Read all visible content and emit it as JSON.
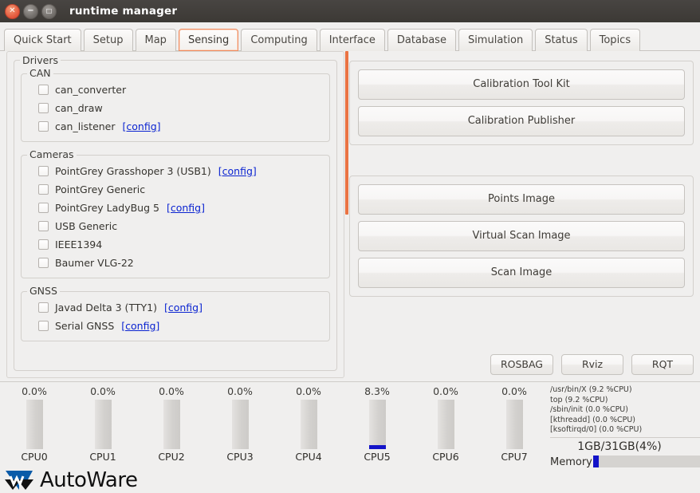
{
  "window": {
    "title": "runtime manager",
    "buttons": [
      {
        "name": "close",
        "glyph": "✕"
      },
      {
        "name": "minimize",
        "glyph": "−"
      },
      {
        "name": "maximize",
        "glyph": "□"
      }
    ]
  },
  "tabs": [
    {
      "label": "Quick Start",
      "active": false
    },
    {
      "label": "Setup",
      "active": false
    },
    {
      "label": "Map",
      "active": false
    },
    {
      "label": "Sensing",
      "active": true
    },
    {
      "label": "Computing",
      "active": false
    },
    {
      "label": "Interface",
      "active": false
    },
    {
      "label": "Database",
      "active": false
    },
    {
      "label": "Simulation",
      "active": false
    },
    {
      "label": "Status",
      "active": false
    },
    {
      "label": "Topics",
      "active": false
    }
  ],
  "drivers": {
    "legend": "Drivers",
    "groups": [
      {
        "legend": "CAN",
        "items": [
          {
            "label": "can_converter",
            "checked": false,
            "config": ""
          },
          {
            "label": "can_draw",
            "checked": false,
            "config": ""
          },
          {
            "label": "can_listener",
            "checked": false,
            "config": "[config]"
          }
        ]
      },
      {
        "legend": "Cameras",
        "items": [
          {
            "label": "PointGrey Grasshoper 3 (USB1)",
            "checked": false,
            "config": "[config]"
          },
          {
            "label": "PointGrey Generic",
            "checked": false,
            "config": ""
          },
          {
            "label": "PointGrey LadyBug 5",
            "checked": false,
            "config": "[config]"
          },
          {
            "label": "USB Generic",
            "checked": false,
            "config": ""
          },
          {
            "label": "IEEE1394",
            "checked": false,
            "config": ""
          },
          {
            "label": "Baumer VLG-22",
            "checked": false,
            "config": ""
          }
        ]
      },
      {
        "legend": "GNSS",
        "items": [
          {
            "label": "Javad Delta 3 (TTY1)",
            "checked": false,
            "config": "[config]"
          },
          {
            "label": "Serial GNSS",
            "checked": false,
            "config": "[config]"
          }
        ]
      }
    ]
  },
  "right_panel": {
    "calibration_buttons": [
      {
        "label": "Calibration Tool Kit"
      },
      {
        "label": "Calibration Publisher"
      }
    ],
    "image_buttons": [
      {
        "label": "Points Image"
      },
      {
        "label": "Virtual Scan Image"
      },
      {
        "label": "Scan Image"
      }
    ],
    "tool_buttons": [
      {
        "label": "ROSBAG"
      },
      {
        "label": "Rviz"
      },
      {
        "label": "RQT"
      }
    ]
  },
  "status": {
    "cpus": [
      {
        "name": "CPU0",
        "percent": "0.0%",
        "value": 0.0
      },
      {
        "name": "CPU1",
        "percent": "0.0%",
        "value": 0.0
      },
      {
        "name": "CPU2",
        "percent": "0.0%",
        "value": 0.0
      },
      {
        "name": "CPU3",
        "percent": "0.0%",
        "value": 0.0
      },
      {
        "name": "CPU4",
        "percent": "0.0%",
        "value": 0.0
      },
      {
        "name": "CPU5",
        "percent": "8.3%",
        "value": 8.3
      },
      {
        "name": "CPU6",
        "percent": "0.0%",
        "value": 0.0
      },
      {
        "name": "CPU7",
        "percent": "0.0%",
        "value": 0.0
      }
    ],
    "processes": [
      "/usr/bin/X (9.2 %CPU)",
      "top (9.2 %CPU)",
      "/sbin/init (0.0 %CPU)",
      "[kthreadd] (0.0 %CPU)",
      "[ksoftirqd/0] (0.0 %CPU)"
    ],
    "memory_text": "1GB/31GB(4%)",
    "memory_label": "Memory",
    "memory_percent": 4
  },
  "footer": {
    "logo_text": "AutoWare",
    "logo_blue": "#0a5ba8",
    "logo_black": "#111111"
  },
  "colors": {
    "accent_orange": "#ea7343",
    "link_blue": "#0b24d1",
    "gauge_blue": "#1313c8",
    "window_bg": "#f0efee"
  }
}
